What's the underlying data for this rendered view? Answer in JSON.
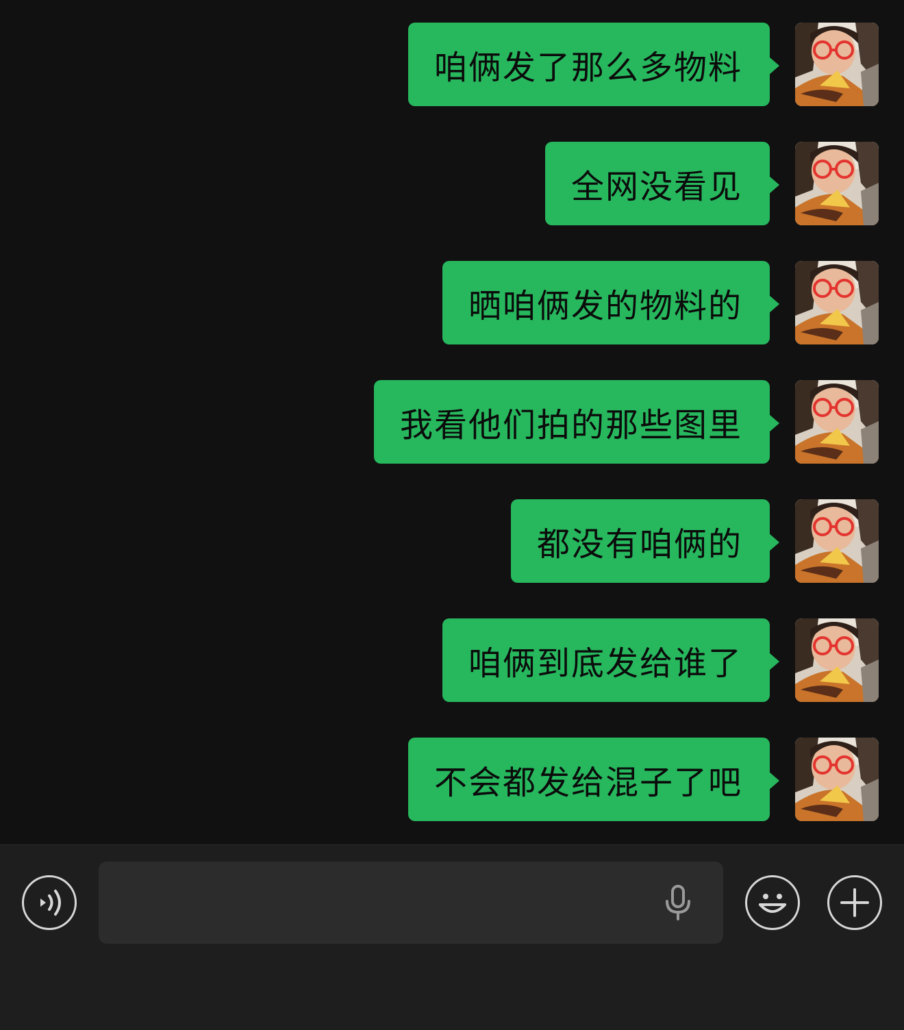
{
  "messages": [
    {
      "text": "咱俩发了那么多物料"
    },
    {
      "text": "全网没看见"
    },
    {
      "text": "晒咱俩发的物料的"
    },
    {
      "text": "我看他们拍的那些图里"
    },
    {
      "text": "都没有咱俩的"
    },
    {
      "text": "咱俩到底发给谁了"
    },
    {
      "text": "不会都发给混子了吧"
    }
  ],
  "input_bar": {
    "placeholder": "",
    "value": "",
    "icons": [
      "voice-icon",
      "microphone-icon",
      "emoji-icon",
      "plus-icon"
    ]
  },
  "colors": {
    "background": "#111111",
    "bubble": "#27b85e",
    "input_bar": "#1e1e1e",
    "text_field": "#2c2c2c"
  }
}
